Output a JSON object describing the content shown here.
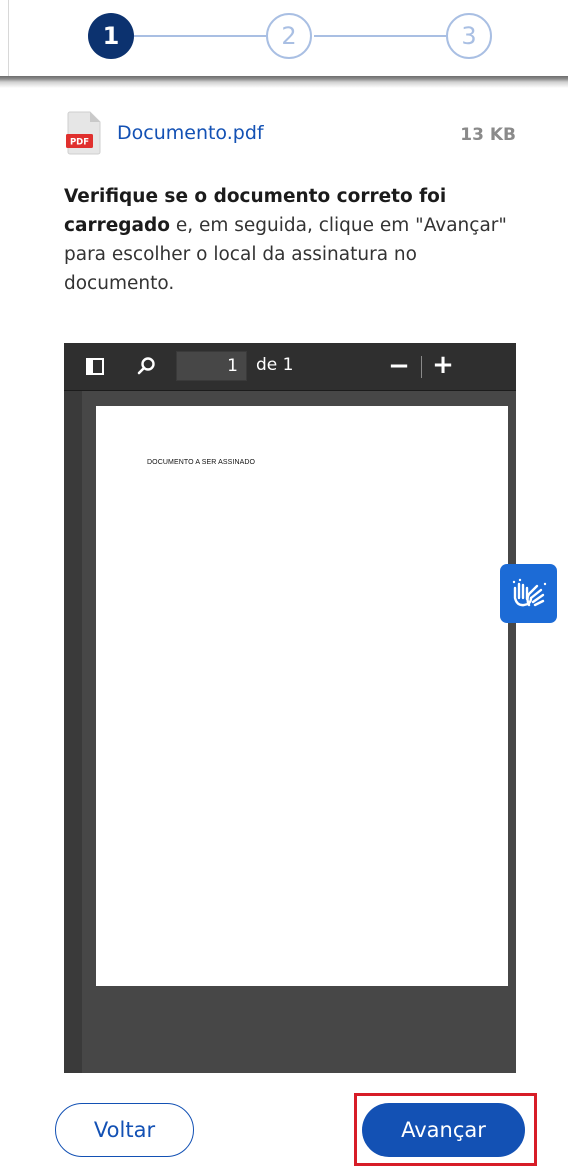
{
  "stepper": {
    "steps": [
      {
        "label": "1",
        "state": "active"
      },
      {
        "label": "2",
        "state": "pending"
      },
      {
        "label": "3",
        "state": "pending"
      }
    ]
  },
  "file": {
    "type_label": "PDF",
    "name": "Documento.pdf",
    "size": "13 KB"
  },
  "instruction": {
    "bold_part": "Verifique se o documento correto foi carregado",
    "rest": " e, em seguida, clique em \"Avançar\" para escolher o local da assinatura no documento."
  },
  "viewer": {
    "page_number": "1",
    "page_total_label": "de 1",
    "zoom_out_label": "−",
    "zoom_in_label": "+",
    "page_content": "DOCUMENTO A SER ASSINADO"
  },
  "icons": {
    "sidebar_toggle": "sidebar-toggle-icon",
    "search": "search-icon",
    "libras": "sign-language-hands-icon",
    "pdf_file": "pdf-file-icon"
  },
  "actions": {
    "back_label": "Voltar",
    "next_label": "Avançar"
  },
  "colors": {
    "primary": "#1351b4",
    "step_active": "#0c326f",
    "step_pending": "#a9bfe3",
    "highlight": "#d71d28",
    "pdf_red": "#e0302e",
    "libras_blue": "#1c6bd6"
  }
}
